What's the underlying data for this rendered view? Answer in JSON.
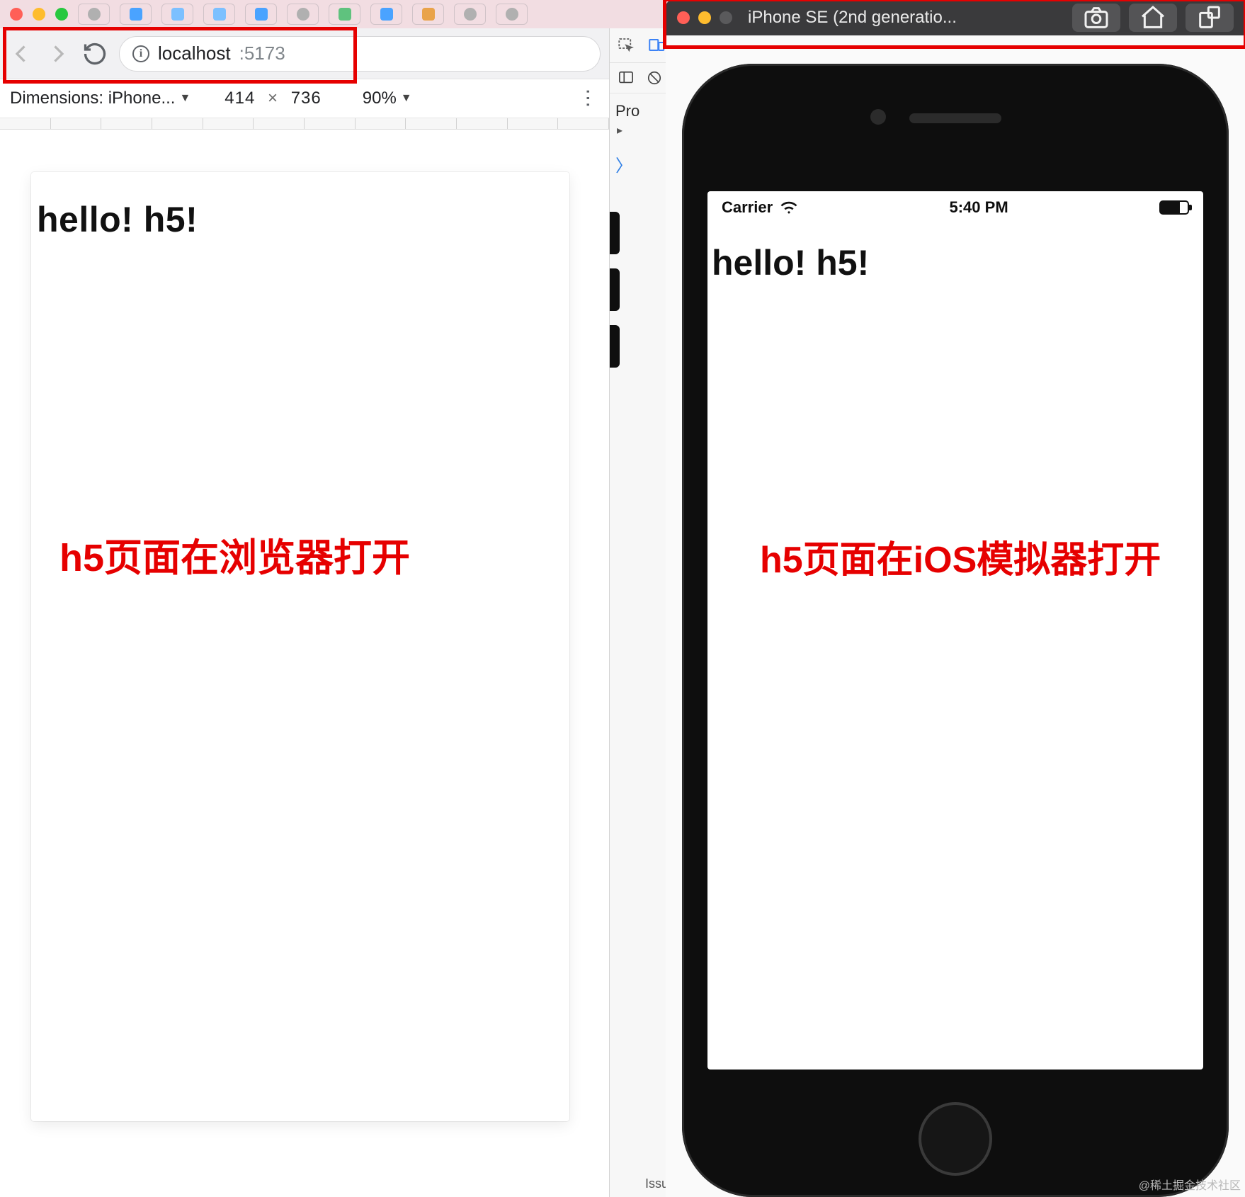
{
  "browser": {
    "url_host": "localhost",
    "url_port": ":5173",
    "device_label": "Dimensions: iPhone...",
    "width": "414",
    "height": "736",
    "zoom": "90%"
  },
  "left_page": {
    "hello": "hello! h5!",
    "annotation": "h5页面在浏览器打开"
  },
  "xcode_snip": {
    "project_label": "Pro",
    "issue_label": "Issu"
  },
  "simulator": {
    "window_title": "iPhone SE (2nd generatio...",
    "statusbar": {
      "carrier": "Carrier",
      "time": "5:40 PM"
    },
    "hello": "hello! h5!",
    "annotation": "h5页面在iOS模拟器打开"
  },
  "watermark": "@稀土掘金技术社区"
}
